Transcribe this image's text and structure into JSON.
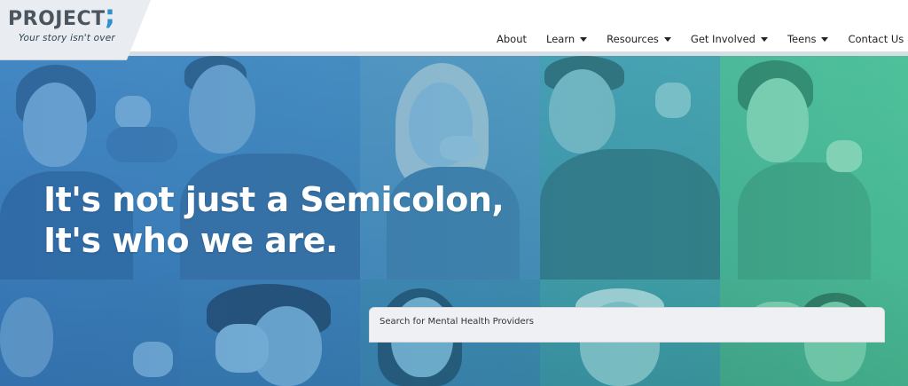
{
  "brand": {
    "logo_text": "PROJECT",
    "logo_mark": ";",
    "tagline": "Your story isn't over"
  },
  "nav": {
    "items": [
      {
        "label": "About",
        "dropdown": false
      },
      {
        "label": "Learn",
        "dropdown": true
      },
      {
        "label": "Resources",
        "dropdown": true
      },
      {
        "label": "Get Involved",
        "dropdown": true
      },
      {
        "label": "Teens",
        "dropdown": true
      },
      {
        "label": "Contact Us",
        "dropdown": false
      }
    ]
  },
  "hero": {
    "headline_line1": "It's not just a Semicolon,",
    "headline_line2": "It's who we are."
  },
  "search": {
    "label": "Search for Mental Health Providers"
  },
  "colors": {
    "hero_left": "#3f87c6",
    "hero_right": "#4bc196",
    "accent_dot": "#2f8fcf"
  }
}
